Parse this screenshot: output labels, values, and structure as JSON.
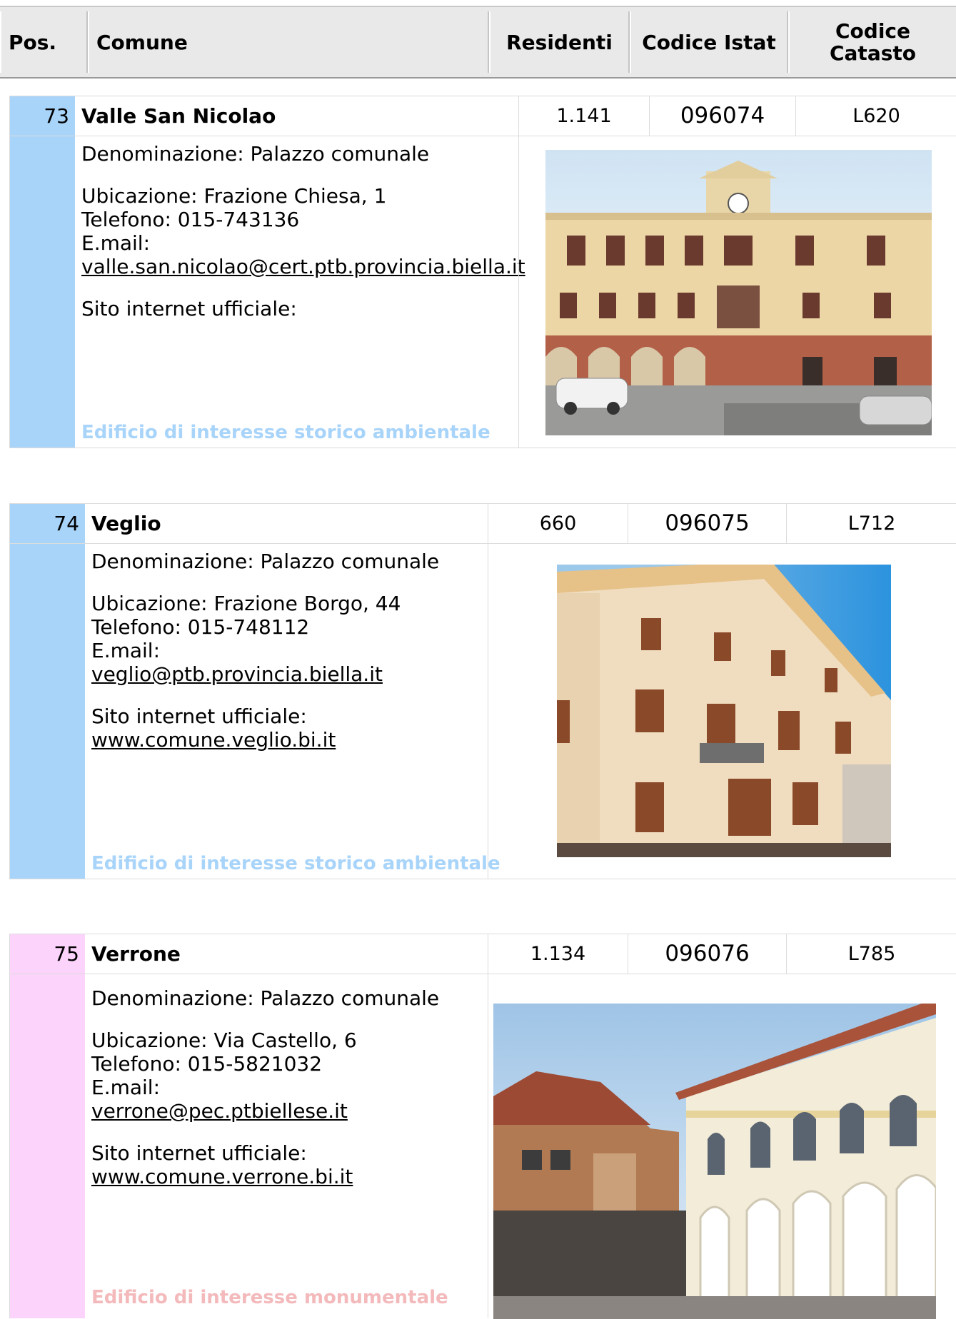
{
  "header": {
    "pos": "Pos.",
    "comune": "Comune",
    "residenti": "Residenti",
    "codice_istat": "Codice Istat",
    "codice_catasto_1": "Codice",
    "codice_catasto_2": "Catasto"
  },
  "entries": [
    {
      "pos": "73",
      "name": "Valle San Nicolao",
      "residenti": "1.141",
      "istat": "096074",
      "catasto": "L620",
      "denominazione": "Denominazione: Palazzo comunale",
      "ubicazione": "Ubicazione: Frazione Chiesa, 1",
      "telefono": "Telefono: 015-743136",
      "email_label": "E.mail:",
      "email": "valle.san.nicolao@cert.ptb.provincia.biella.it",
      "sito_label": "Sito internet ufficiale:",
      "sito": "",
      "category": "Edificio di interesse storico ambientale",
      "color": "#a8d4fa"
    },
    {
      "pos": "74",
      "name": "Veglio",
      "residenti": "660",
      "istat": "096075",
      "catasto": "L712",
      "denominazione": "Denominazione: Palazzo comunale",
      "ubicazione": "Ubicazione: Frazione Borgo, 44",
      "telefono": "Telefono: 015-748112",
      "email_label": "E.mail:",
      "email": "veglio@ptb.provincia.biella.it",
      "sito_label": "Sito internet ufficiale:",
      "sito": "www.comune.veglio.bi.it",
      "category": "Edificio di interesse storico ambientale",
      "color": "#a8d4fa"
    },
    {
      "pos": "75",
      "name": "Verrone",
      "residenti": "1.134",
      "istat": "096076",
      "catasto": "L785",
      "denominazione": "Denominazione: Palazzo comunale",
      "ubicazione": "Ubicazione: Via Castello, 6",
      "telefono": "Telefono: 015-5821032",
      "email_label": "E.mail:",
      "email": "verrone@pec.ptbiellese.it",
      "sito_label": "Sito internet ufficiale:",
      "sito": "www.comune.verrone.bi.it",
      "category": "Edificio di interesse monumentale",
      "color": "#fcd4fb"
    }
  ]
}
